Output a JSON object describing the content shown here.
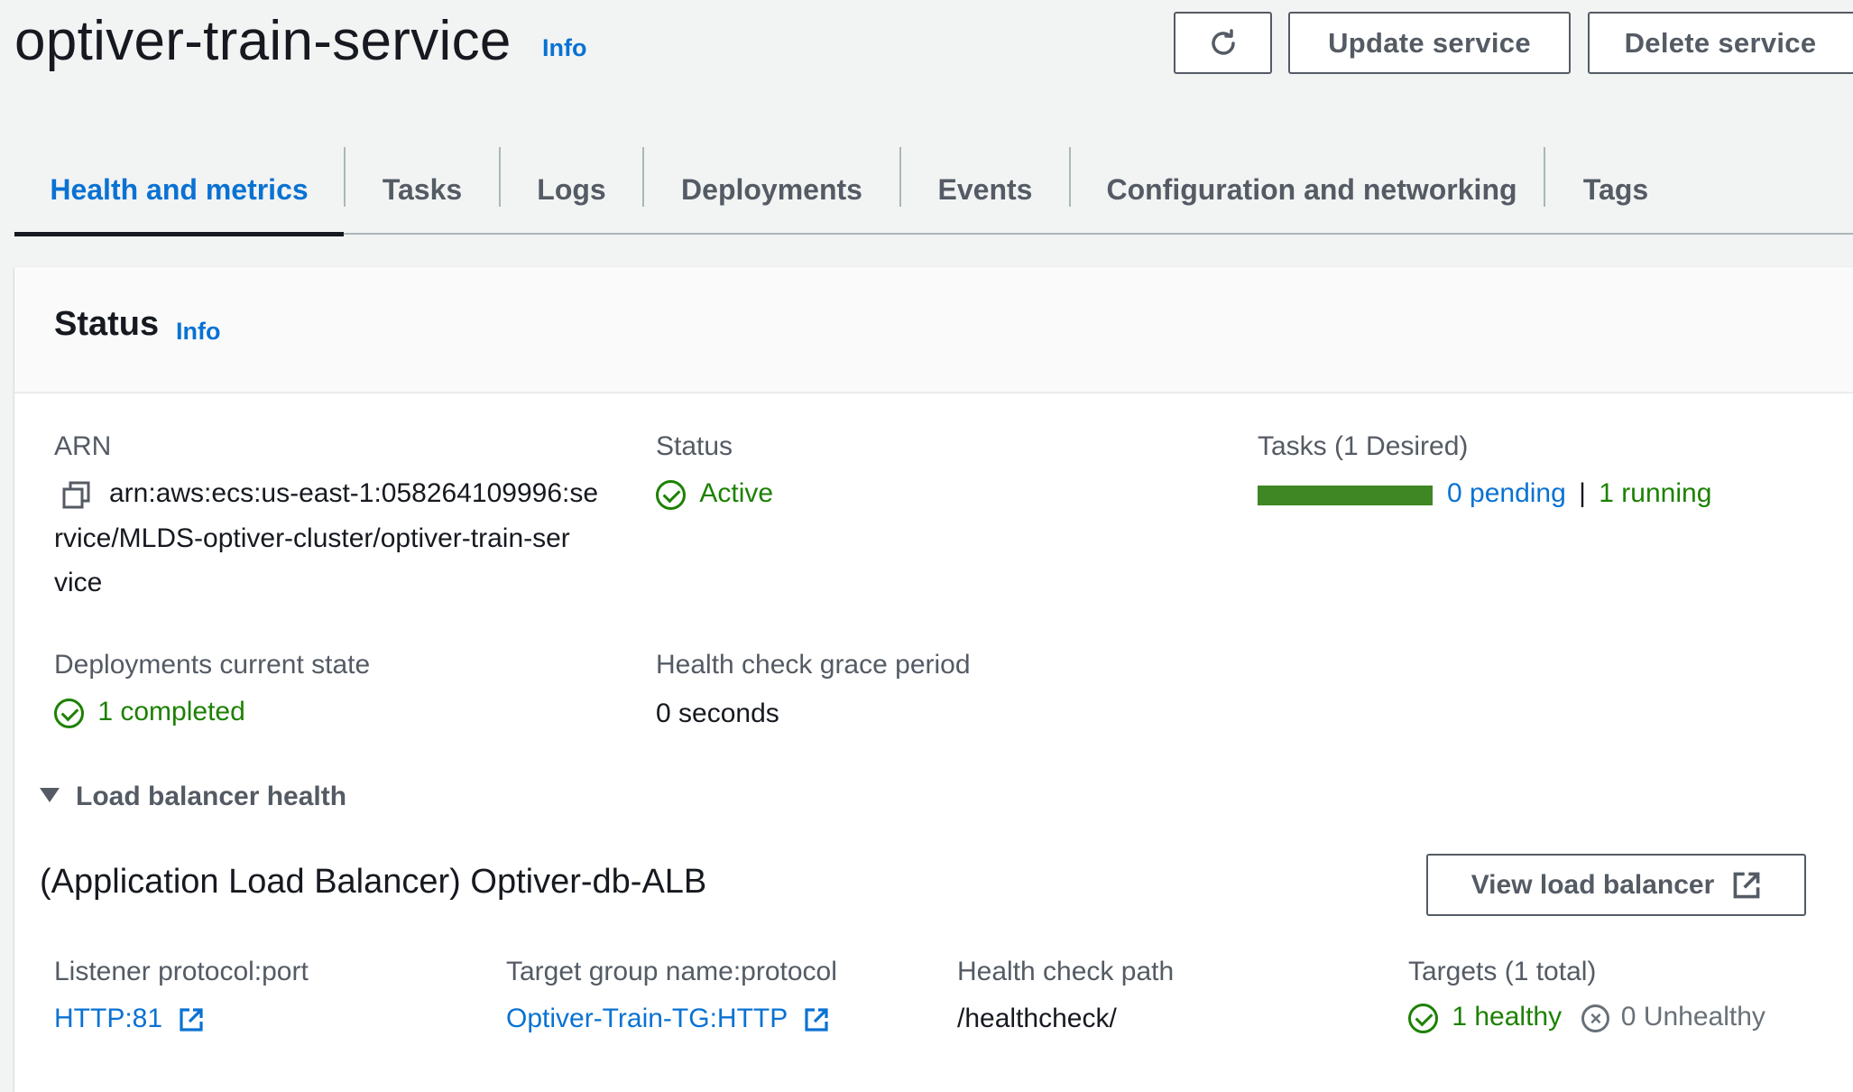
{
  "header": {
    "title": "optiver-train-service",
    "info": "Info",
    "buttons": {
      "refresh_icon": "refresh-icon",
      "update": "Update service",
      "delete": "Delete service"
    }
  },
  "tabs": [
    {
      "label": "Health and metrics",
      "active": true
    },
    {
      "label": "Tasks"
    },
    {
      "label": "Logs"
    },
    {
      "label": "Deployments"
    },
    {
      "label": "Events"
    },
    {
      "label": "Configuration and networking"
    },
    {
      "label": "Tags"
    }
  ],
  "status_section": {
    "title": "Status",
    "info": "Info",
    "arn": {
      "label": "ARN",
      "line1": "arn:aws:ecs:us-east-1:058264109996:se",
      "line2": "rvice/MLDS-optiver-cluster/optiver-train-ser",
      "line3": "vice"
    },
    "status": {
      "label": "Status",
      "value": "Active"
    },
    "tasks": {
      "label": "Tasks (1 Desired)",
      "pending": "0 pending",
      "separator": "|",
      "running": "1 running",
      "running_fraction": 1.0
    },
    "deployments": {
      "label": "Deployments current state",
      "value": "1 completed"
    },
    "grace": {
      "label": "Health check grace period",
      "value": "0 seconds"
    },
    "load_balancer": {
      "toggle": "Load balancer health",
      "title": "(Application Load Balancer) Optiver-db-ALB",
      "view_button": "View load balancer",
      "listener": {
        "label": "Listener protocol:port",
        "value": "HTTP:81"
      },
      "target_group": {
        "label": "Target group name:protocol",
        "value": "Optiver-Train-TG:HTTP"
      },
      "health_path": {
        "label": "Health check path",
        "value": "/healthcheck/"
      },
      "targets": {
        "label": "Targets (1 total)",
        "healthy": "1 healthy",
        "unhealthy": "0 Unhealthy"
      }
    }
  },
  "colors": {
    "link": "#0972d3",
    "success": "#1d8102",
    "progress": "#3f8624",
    "text": "#16191f",
    "muted": "#545b64"
  }
}
